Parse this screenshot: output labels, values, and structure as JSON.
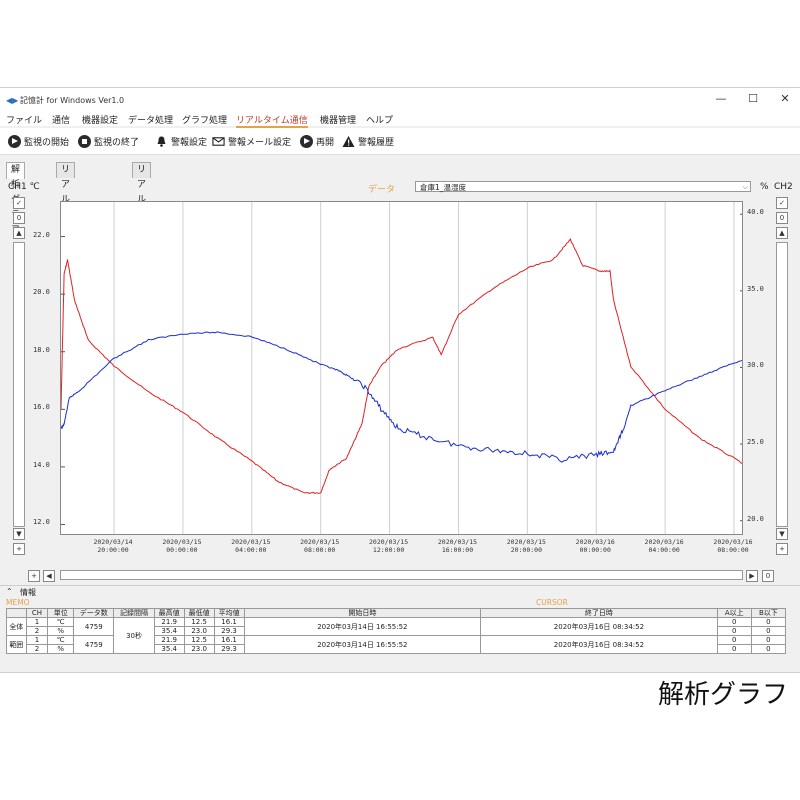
{
  "window": {
    "title": "記憶計 for Windows Ver1.0",
    "controls": [
      "—",
      "☐",
      "✕"
    ]
  },
  "menu": [
    {
      "label": "ファイル"
    },
    {
      "label": "通信"
    },
    {
      "label": "機器設定"
    },
    {
      "label": "データ処理"
    },
    {
      "label": "グラフ処理"
    },
    {
      "label": "リアルタイム通信"
    },
    {
      "label": "機器管理"
    },
    {
      "label": "ヘルプ"
    }
  ],
  "toolbar": [
    {
      "label": "監視の開始",
      "icon": "play-icon"
    },
    {
      "label": "監視の終了",
      "icon": "stop-icon"
    },
    {
      "label": "警報設定",
      "icon": "bell-icon"
    },
    {
      "label": "警報メール設定",
      "icon": "mail-icon"
    },
    {
      "label": "再開",
      "icon": "resume-icon"
    },
    {
      "label": "警報履歴",
      "icon": "warning-icon"
    }
  ],
  "tabs": [
    {
      "label": "解析グラフ"
    },
    {
      "label": "リアルタイムグラフ"
    },
    {
      "label": "リアルタイムモニタ"
    }
  ],
  "channel_bar": {
    "left": "CH1 ℃",
    "data_label": "データ",
    "selected": "倉庫1_温湿度",
    "right_unit": "%",
    "right_ch": "CH2"
  },
  "chart_data": {
    "type": "line",
    "x_ticks": [
      "2020/03/14\n20:00:00",
      "2020/03/15\n00:00:00",
      "2020/03/15\n04:00:00",
      "2020/03/15\n08:00:00",
      "2020/03/15\n12:00:00",
      "2020/03/15\n16:00:00",
      "2020/03/15\n20:00:00",
      "2020/03/16\n00:00:00",
      "2020/03/16\n04:00:00",
      "2020/03/16\n08:00:00"
    ],
    "y_left": {
      "ticks": [
        "22.0",
        "20.0",
        "18.0",
        "16.0",
        "14.0",
        "12.0"
      ],
      "values": [
        22,
        20,
        18,
        16,
        14,
        12
      ],
      "range": [
        11.6,
        23.2
      ]
    },
    "y_right": {
      "ticks": [
        "40.0",
        "35.0",
        "30.0",
        "25.0",
        "20.0"
      ],
      "values": [
        40,
        35,
        30,
        25,
        20
      ],
      "range": [
        19.0,
        40.8
      ]
    },
    "time_range_h": [
      16.92,
      56.58
    ],
    "series": [
      {
        "color": "#dd2222",
        "axis": "left",
        "points": [
          [
            16.92,
            16.0
          ],
          [
            17.1,
            20.7
          ],
          [
            17.3,
            21.2
          ],
          [
            17.7,
            19.8
          ],
          [
            18.5,
            18.4
          ],
          [
            20,
            17.5
          ],
          [
            22,
            16.6
          ],
          [
            24,
            15.9
          ],
          [
            26,
            15.0
          ],
          [
            28,
            14.2
          ],
          [
            29.5,
            13.5
          ],
          [
            31,
            13.1
          ],
          [
            32,
            13.1
          ],
          [
            32.5,
            13.9
          ],
          [
            33.5,
            14.3
          ],
          [
            34.4,
            15.5
          ],
          [
            34.8,
            16.8
          ],
          [
            35.5,
            17.5
          ],
          [
            36.5,
            18.1
          ],
          [
            38.5,
            18.5
          ],
          [
            39,
            17.9
          ],
          [
            40,
            19.3
          ],
          [
            42,
            20.2
          ],
          [
            44,
            20.9
          ],
          [
            45.5,
            21.2
          ],
          [
            46.5,
            21.9
          ],
          [
            47.2,
            21.0
          ],
          [
            48.2,
            20.8
          ],
          [
            48.8,
            20.8
          ],
          [
            49,
            19.8
          ],
          [
            50,
            17.5
          ],
          [
            52,
            16.0
          ],
          [
            54,
            15.0
          ],
          [
            56,
            14.3
          ],
          [
            58,
            13.6
          ],
          [
            60,
            13.0
          ],
          [
            62,
            12.6
          ],
          [
            63.5,
            12.5
          ],
          [
            64.3,
            12.5
          ],
          [
            64.9,
            13.0
          ],
          [
            65.4,
            14.6
          ],
          [
            65.9,
            16.0
          ],
          [
            66.2,
            17.5
          ],
          [
            66.6,
            20.0
          ],
          [
            67.0,
            18.7
          ],
          [
            67.4,
            19.2
          ]
        ]
      },
      {
        "color": "#1a2fcc",
        "axis": "right",
        "points": [
          [
            16.92,
            26.0
          ],
          [
            17.1,
            26.3
          ],
          [
            17.4,
            28.0
          ],
          [
            18,
            28.5
          ],
          [
            20,
            30.6
          ],
          [
            22,
            31.8
          ],
          [
            24,
            32.2
          ],
          [
            26,
            32.3
          ],
          [
            28,
            32.0
          ],
          [
            30,
            31.2
          ],
          [
            32,
            30.2
          ],
          [
            33,
            29.8
          ],
          [
            33.5,
            29.5
          ],
          [
            34.5,
            28.8
          ],
          [
            35.5,
            27.3
          ],
          [
            36.5,
            26.0
          ],
          [
            38,
            25.5
          ],
          [
            40,
            24.9
          ],
          [
            42,
            24.6
          ],
          [
            44,
            24.4
          ],
          [
            46,
            24.0
          ],
          [
            48,
            24.3
          ],
          [
            49,
            24.5
          ],
          [
            49.6,
            26.0
          ],
          [
            50,
            27.5
          ],
          [
            52,
            28.5
          ],
          [
            54,
            29.4
          ],
          [
            56,
            30.3
          ],
          [
            58,
            31.0
          ],
          [
            60,
            32.2
          ],
          [
            62,
            33.4
          ],
          [
            64,
            34.2
          ],
          [
            65,
            33.8
          ],
          [
            65.8,
            30.2
          ],
          [
            66.2,
            32.0
          ],
          [
            66.6,
            30.4
          ],
          [
            67.0,
            31.3
          ],
          [
            67.4,
            31.0
          ]
        ]
      }
    ]
  },
  "info": {
    "header": "情報",
    "memo_label": "MEMO",
    "cursor_label": "CURSOR",
    "columns": [
      "CH",
      "単位",
      "データ数",
      "記録間隔",
      "最高値",
      "最低値",
      "平均値",
      "開始日時",
      "終了日時",
      "A以上",
      "B以下"
    ],
    "rows": [
      {
        "group": "全体",
        "ch": "1",
        "unit": "℃",
        "count": "4759",
        "interval": "30秒",
        "max": "21.9",
        "min": "12.5",
        "avg": "16.1",
        "start": "2020年03月14日 16:55:52",
        "end": "2020年03月16日 08:34:52",
        "a": "0",
        "b": "0"
      },
      {
        "group": "",
        "ch": "2",
        "unit": "%",
        "count": "",
        "interval": "",
        "max": "35.4",
        "min": "23.0",
        "avg": "29.3",
        "start": "",
        "end": "",
        "a": "0",
        "b": "0"
      },
      {
        "group": "範囲",
        "ch": "1",
        "unit": "℃",
        "count": "4759",
        "interval": "",
        "max": "21.9",
        "min": "12.5",
        "avg": "16.1",
        "start": "2020年03月14日 16:55:52",
        "end": "2020年03月16日 08:34:52",
        "a": "0",
        "b": "0"
      },
      {
        "group": "",
        "ch": "2",
        "unit": "%",
        "count": "",
        "interval": "",
        "max": "35.4",
        "min": "23.0",
        "avg": "29.3",
        "start": "",
        "end": "",
        "a": "0",
        "b": "0"
      }
    ]
  },
  "caption": "解析グラフ"
}
